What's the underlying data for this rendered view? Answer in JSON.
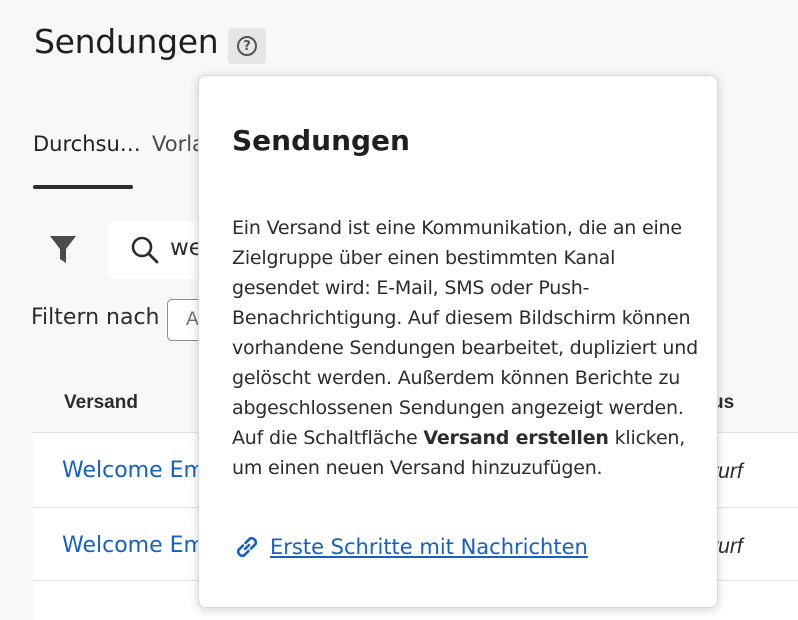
{
  "page": {
    "title": "Sendungen"
  },
  "help": {
    "icon": "help-circle-icon",
    "glyph": "?"
  },
  "tabs": [
    {
      "label": "Durchsu…",
      "selected": true
    },
    {
      "label": "Vorla"
    }
  ],
  "toolbar": {
    "filter_icon": "funnel-icon"
  },
  "search": {
    "icon": "search-icon",
    "value": "we"
  },
  "filter": {
    "label": "Filtern nach",
    "select_value": "A"
  },
  "table": {
    "columns": [
      "Versand",
      "us"
    ],
    "rows": [
      {
        "name": "Welcome Em",
        "status": "wurf"
      },
      {
        "name": "Welcome Em",
        "status": "wurf"
      },
      {
        "name": "",
        "status": ""
      }
    ]
  },
  "popover": {
    "title": "Sendungen",
    "body_before": "Ein Versand ist eine Kommunikation, die an eine Zielgruppe über einen bestimmten Kanal gesendet wird: E-Mail, SMS oder Push-Benachrichtigung. Auf diesem Bildschirm können vorhandene Sendungen bearbeitet, dupliziert und gelöscht werden. Außerdem können Berichte zu abgeschlossenen Sendungen angezeigt werden. Auf die Schaltfläche ",
    "body_bold": "Versand erstellen",
    "body_after": " klicken, um einen neuen Versand hinzuzufügen.",
    "link_icon": "link-icon",
    "link_text": "Erste Schritte mit Nachrichten"
  },
  "colors": {
    "accent": "#1560c4",
    "text": "#2c2c2c",
    "background": "#f8f8f8"
  }
}
